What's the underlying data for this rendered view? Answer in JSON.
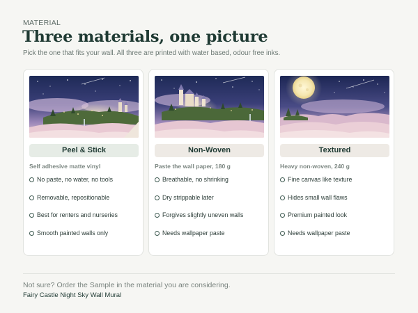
{
  "header": {
    "eyebrow": "MATERIAL",
    "title": "Three materials, one picture",
    "subtitle": "Pick the one that fits your wall. All three are printed with water based, odour free inks."
  },
  "cards": [
    {
      "name": "Peel & Stick",
      "spec": "Self adhesive matte vinyl",
      "features": [
        "No paste, no water, no tools",
        "Removable, repositionable",
        "Best for renters and nurseries",
        "Smooth painted walls only"
      ],
      "accent": "#e6ece6"
    },
    {
      "name": "Non-Woven",
      "spec": "Paste the wall paper, 180 g",
      "features": [
        "Breathable, no shrinking",
        "Dry strippable later",
        "Forgives slightly uneven walls",
        "Needs wallpaper paste"
      ],
      "accent": "#eeeae5"
    },
    {
      "name": "Textured",
      "spec": "Heavy non-woven, 240 g",
      "features": [
        "Fine canvas like texture",
        "Hides small wall flaws",
        "Premium painted look",
        "Needs wallpaper paste"
      ],
      "accent": "#eeeae5"
    }
  ],
  "footer": {
    "note": "Not sure? Order the Sample in the material you are considering.",
    "product": "Fairy Castle Night Sky Wall Mural"
  }
}
